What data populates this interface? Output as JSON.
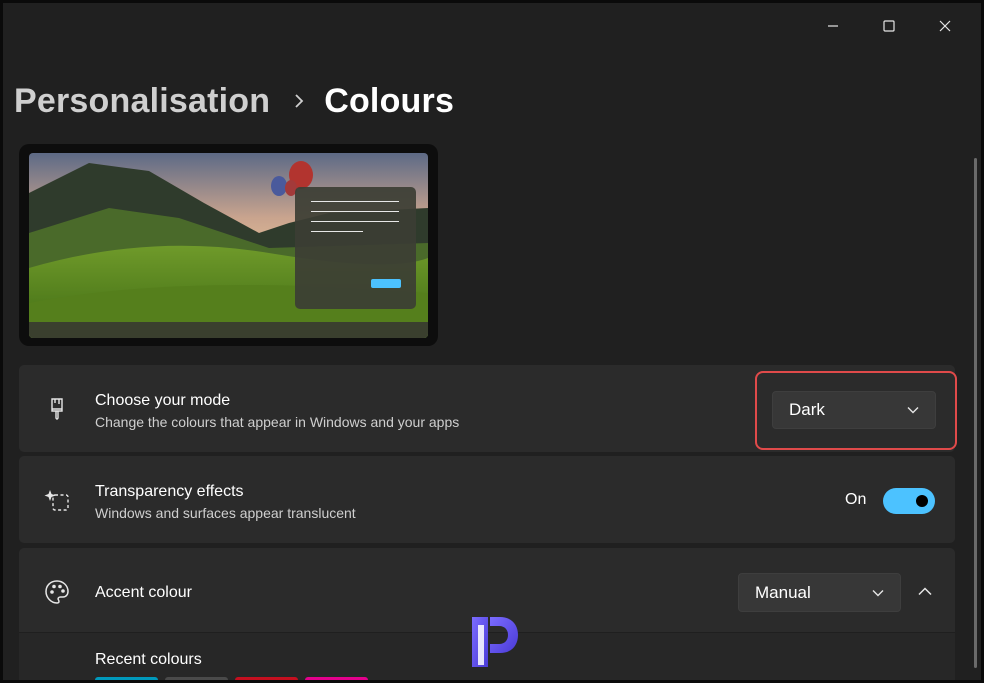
{
  "window": {
    "controls": {
      "minimize": "minimize-icon",
      "maximize": "maximize-icon",
      "close": "close-icon"
    }
  },
  "breadcrumb": {
    "parent": "Personalisation",
    "current": "Colours"
  },
  "mode": {
    "title": "Choose your mode",
    "description": "Change the colours that appear in Windows and your apps",
    "value": "Dark",
    "icon": "brush-icon"
  },
  "transparency": {
    "title": "Transparency effects",
    "description": "Windows and surfaces appear translucent",
    "state_label": "On",
    "on": true,
    "icon": "transparency-icon"
  },
  "accent": {
    "title": "Accent colour",
    "value": "Manual",
    "icon": "palette-icon",
    "recent_label": "Recent colours",
    "recent_colors": [
      "#0099bc",
      "#4a4a4a",
      "#c50f1f",
      "#e3008c"
    ]
  },
  "colors": {
    "accent": "#4cc2ff",
    "highlight": "#e04a4a",
    "card": "#2b2b2b",
    "background": "#202020"
  }
}
